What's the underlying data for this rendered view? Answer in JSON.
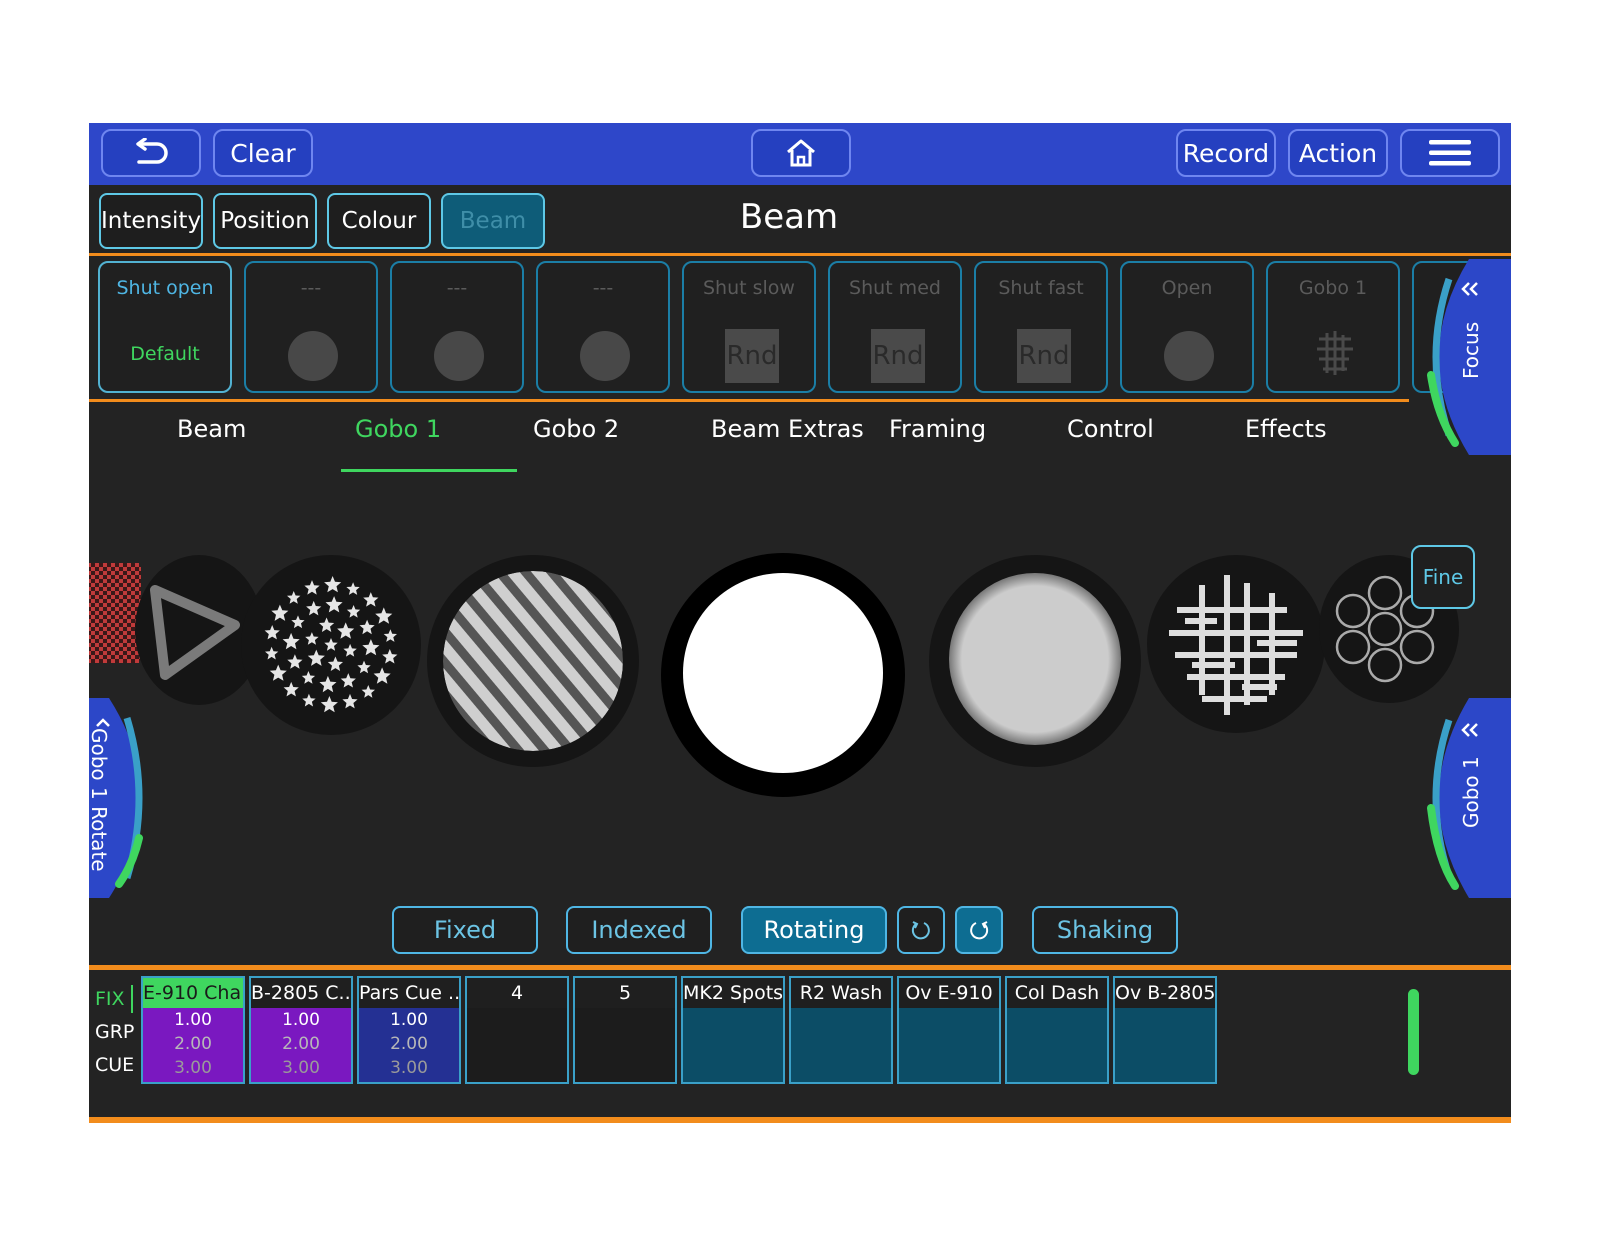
{
  "topbar": {
    "clear_label": "Clear",
    "record_label": "Record",
    "action_label": "Action"
  },
  "attribute_tabs": [
    {
      "label": "Intensity",
      "active": false
    },
    {
      "label": "Position",
      "active": false
    },
    {
      "label": "Colour",
      "active": false
    },
    {
      "label": "Beam",
      "active": true
    }
  ],
  "page_title": "Beam",
  "palettes": [
    {
      "label": "Shut open",
      "value": "Default",
      "kind": "text"
    },
    {
      "label": "---",
      "kind": "dot"
    },
    {
      "label": "---",
      "kind": "dot"
    },
    {
      "label": "---",
      "kind": "dot"
    },
    {
      "label": "Shut slow",
      "value": "Rnd",
      "kind": "rnd"
    },
    {
      "label": "Shut med",
      "value": "Rnd",
      "kind": "rnd"
    },
    {
      "label": "Shut fast",
      "value": "Rnd",
      "kind": "rnd"
    },
    {
      "label": "Open",
      "kind": "dot"
    },
    {
      "label": "Gobo 1",
      "kind": "gobo"
    }
  ],
  "sub_tabs": [
    {
      "label": "Beam",
      "active": false
    },
    {
      "label": "Gobo 1",
      "active": true
    },
    {
      "label": "Gobo 2",
      "active": false
    },
    {
      "label": "Beam Extras",
      "active": false
    },
    {
      "label": "Framing",
      "active": false
    },
    {
      "label": "Control",
      "active": false
    },
    {
      "label": "Effects",
      "active": false
    }
  ],
  "gobo_wheel": [
    "checker",
    "triangle",
    "stars",
    "stripes",
    "open",
    "soft",
    "breakup",
    "rings"
  ],
  "wheels": {
    "left": {
      "label": "Gobo 1 Rotate"
    },
    "right_top": {
      "label": "Focus"
    },
    "right_bottom": {
      "label": "Gobo 1"
    }
  },
  "fine_label": "Fine",
  "modes": [
    {
      "label": "Fixed",
      "active": false
    },
    {
      "label": "Indexed",
      "active": false
    },
    {
      "label": "Rotating",
      "active": true
    },
    {
      "label": "Shaking",
      "active": false
    }
  ],
  "rotate_icons": [
    "rotate-ccw-icon",
    "rotate-cw-icon"
  ],
  "bottom": {
    "row_labels": [
      "FIX",
      "GRP",
      "CUE"
    ],
    "fixtures": [
      {
        "name": "E-910 Cha...",
        "values": [
          "1.00",
          "2.00",
          "3.00"
        ],
        "style": "purple",
        "selected": true
      },
      {
        "name": "B-2805 C...",
        "values": [
          "1.00",
          "2.00",
          "3.00"
        ],
        "style": "purple",
        "selected": false
      },
      {
        "name": "Pars Cue ...",
        "values": [
          "1.00",
          "2.00",
          "3.00"
        ],
        "style": "navy",
        "selected": false
      },
      {
        "name": "4",
        "values": [],
        "style": "dark",
        "selected": false
      },
      {
        "name": "5",
        "values": [],
        "style": "dark",
        "selected": false
      },
      {
        "name": "MK2 Spots",
        "values": [],
        "style": "teal",
        "selected": false
      },
      {
        "name": "R2 Wash",
        "values": [],
        "style": "teal",
        "selected": false
      },
      {
        "name": "Ov E-910",
        "values": [],
        "style": "teal",
        "selected": false
      },
      {
        "name": "Col Dash",
        "values": [],
        "style": "teal",
        "selected": false
      },
      {
        "name": "Ov B-2805",
        "values": [],
        "style": "teal",
        "selected": false
      }
    ]
  },
  "colors": {
    "topbar": "#2e47c9",
    "accent_orange": "#f28c1c",
    "accent_green": "#3fd65f",
    "accent_cyan": "#5ec8e6",
    "wheel_blue": "#2c47c8"
  }
}
